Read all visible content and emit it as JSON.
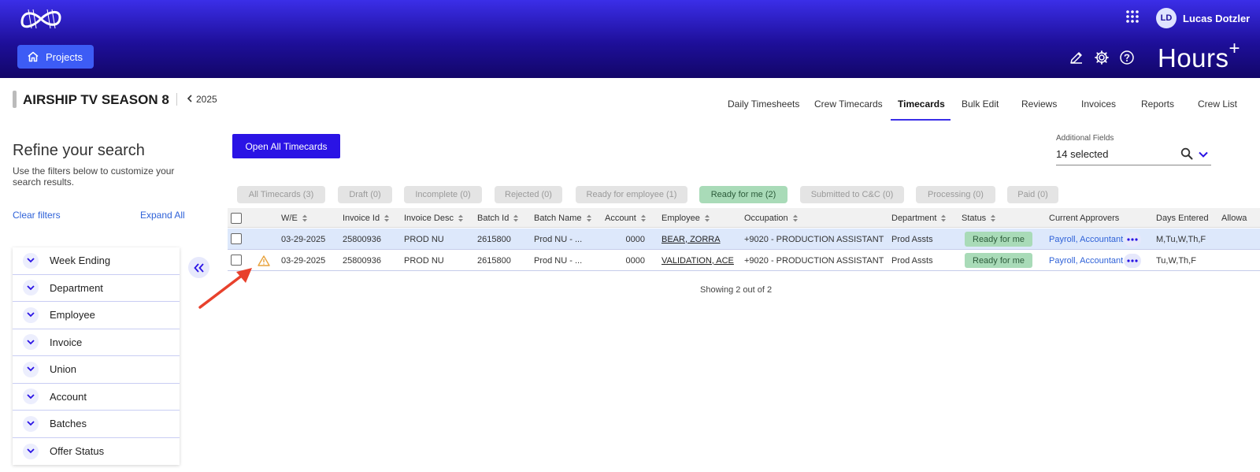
{
  "header": {
    "projects_label": "Projects",
    "user_initials": "LD",
    "user_name": "Lucas Dotzler",
    "brand": "Hours",
    "brand_sup": "+"
  },
  "project": {
    "title": "AIRSHIP TV SEASON 8",
    "year": "2025"
  },
  "tabs": [
    {
      "label": "Daily Timesheets",
      "active": false
    },
    {
      "label": "Crew Timecards",
      "active": false
    },
    {
      "label": "Timecards",
      "active": true
    },
    {
      "label": "Bulk Edit",
      "active": false
    },
    {
      "label": "Reviews",
      "active": false
    },
    {
      "label": "Invoices",
      "active": false
    },
    {
      "label": "Reports",
      "active": false
    },
    {
      "label": "Crew List",
      "active": false
    }
  ],
  "sidebar": {
    "title": "Refine your search",
    "subtitle": "Use the filters below to customize your search results.",
    "clear_filters": "Clear filters",
    "expand_all": "Expand All",
    "filters": [
      "Week Ending",
      "Department",
      "Employee",
      "Invoice",
      "Union",
      "Account",
      "Batches",
      "Offer Status"
    ]
  },
  "main": {
    "open_all_label": "Open All Timecards",
    "additional_fields_label": "Additional Fields",
    "additional_fields_value": "14 selected",
    "chips": [
      {
        "label": "All Timecards (3)",
        "active": false
      },
      {
        "label": "Draft (0)",
        "active": false
      },
      {
        "label": "Incomplete (0)",
        "active": false
      },
      {
        "label": "Rejected (0)",
        "active": false
      },
      {
        "label": "Ready for employee (1)",
        "active": false
      },
      {
        "label": "Ready for me (2)",
        "active": true
      },
      {
        "label": "Submitted to C&C (0)",
        "active": false
      },
      {
        "label": "Processing (0)",
        "active": false
      },
      {
        "label": "Paid (0)",
        "active": false
      }
    ],
    "columns": [
      "W/E",
      "Invoice Id",
      "Invoice Desc",
      "Batch Id",
      "Batch Name",
      "Account",
      "Employee",
      "Occupation",
      "Department",
      "Status",
      "Current Approvers",
      "Days Entered",
      "Allowa"
    ],
    "rows": [
      {
        "warning": false,
        "we": "03-29-2025",
        "invoice_id": "25800936",
        "invoice_desc": "PROD NU",
        "batch_id": "2615800",
        "batch_name": "Prod NU - ...",
        "account": "0000",
        "employee": "BEAR, ZORRA",
        "occupation": "+9020 - PRODUCTION ASSISTANT",
        "department": "Prod Assts",
        "status": "Ready for me",
        "approvers": "Payroll, Accountant",
        "days": "M,Tu,W,Th,F"
      },
      {
        "warning": true,
        "we": "03-29-2025",
        "invoice_id": "25800936",
        "invoice_desc": "PROD NU",
        "batch_id": "2615800",
        "batch_name": "Prod NU - ...",
        "account": "0000",
        "employee": "VALIDATION, ACE",
        "occupation": "+9020 - PRODUCTION ASSISTANT",
        "department": "Prod Assts",
        "status": "Ready for me",
        "approvers": "Payroll, Accountant",
        "days": "Tu,W,Th,F"
      }
    ],
    "showing": "Showing 2 out of 2"
  },
  "colors": {
    "header_top": "#3b2ee8",
    "header_bottom": "#120668",
    "primary_button": "#2a13e5",
    "status_green": "#a9dbb8",
    "link_blue": "#2f62d8",
    "warning": "#e8a33d",
    "annotation_arrow": "#e8412c"
  }
}
